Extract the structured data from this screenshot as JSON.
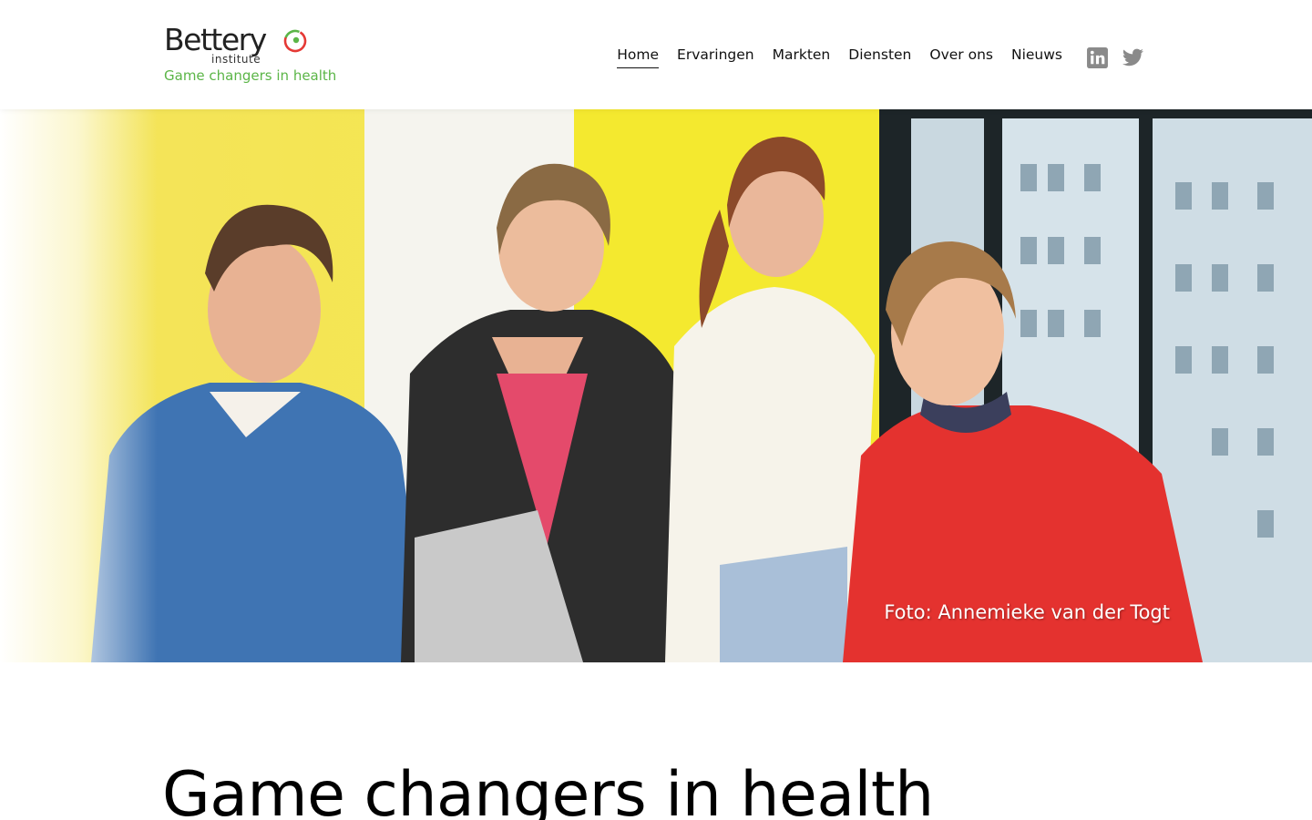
{
  "brand": {
    "name": "Bettery",
    "sub": "institute",
    "tagline": "Game changers in health",
    "colors": {
      "green": "#5bb547",
      "red": "#e53935",
      "text": "#222222"
    }
  },
  "nav": {
    "items": [
      {
        "label": "Home",
        "active": true
      },
      {
        "label": "Ervaringen",
        "active": false
      },
      {
        "label": "Markten",
        "active": false
      },
      {
        "label": "Diensten",
        "active": false
      },
      {
        "label": "Over ons",
        "active": false
      },
      {
        "label": "Nieuws",
        "active": false
      }
    ]
  },
  "social": {
    "icons": [
      "linkedin-icon",
      "twitter-icon"
    ],
    "color": "#8a8a8a"
  },
  "hero": {
    "credit": "Foto: Annemieke van der Togt"
  },
  "main": {
    "title": "Game changers in health"
  }
}
